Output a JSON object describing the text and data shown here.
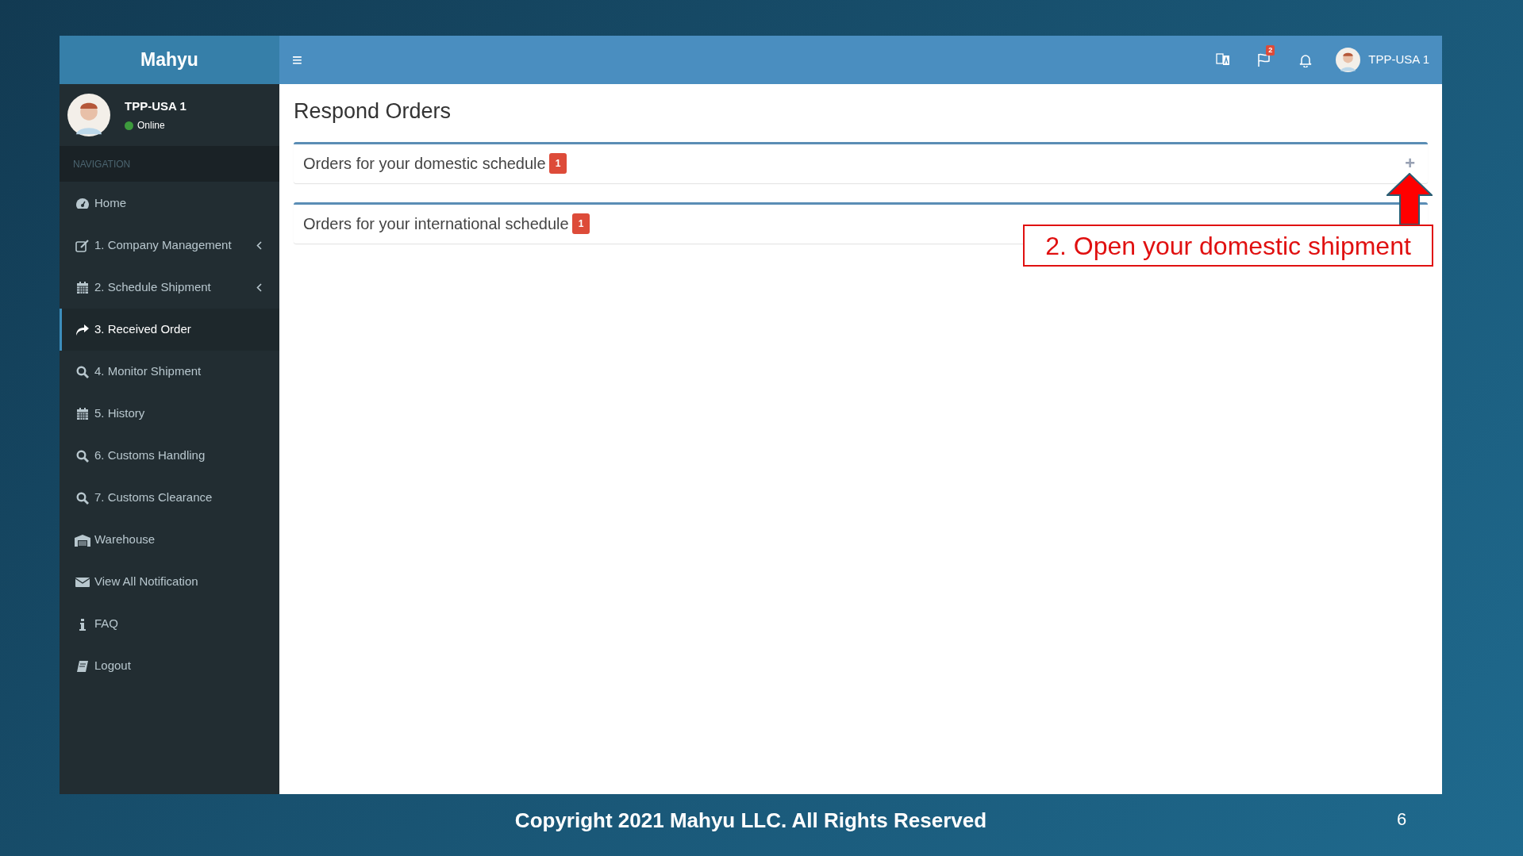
{
  "sidebar": {
    "brand": "Mahyu",
    "user": {
      "name": "TPP-USA 1",
      "status": "Online",
      "color": "#3d9a3d"
    },
    "header": "NAVIGATION",
    "items": [
      {
        "label": "Home",
        "kind": "link",
        "selected": false
      },
      {
        "label": "1. Company Management",
        "kind": "menu",
        "selected": false
      },
      {
        "label": "2. Schedule Shipment",
        "kind": "menu",
        "selected": false
      },
      {
        "label": "3. Received Order",
        "kind": "link",
        "selected": true
      },
      {
        "label": "4. Monitor Shipment",
        "kind": "link",
        "selected": false
      },
      {
        "label": "5. History",
        "kind": "link",
        "selected": false
      },
      {
        "label": "6. Customs Handling",
        "kind": "link",
        "selected": false
      },
      {
        "label": "7. Customs Clearance",
        "kind": "link",
        "selected": false
      },
      {
        "label": "Warehouse",
        "kind": "link",
        "selected": false
      },
      {
        "label": "View All Notification",
        "kind": "link",
        "selected": false
      },
      {
        "label": "FAQ",
        "kind": "link",
        "selected": false
      },
      {
        "label": "Logout",
        "kind": "link",
        "selected": false
      }
    ]
  },
  "topbar": {
    "menu_icon": "≡",
    "flag_count": "2",
    "user_name": "TPP-USA 1"
  },
  "content": {
    "title": "Respond Orders",
    "panels": [
      {
        "title": "Orders for your domestic schedule",
        "count": "1",
        "toggle": "+"
      },
      {
        "title": "Orders for your international schedule",
        "count": "1"
      }
    ]
  },
  "annotation": "2. Open your domestic shipment",
  "footer": {
    "copyright": "Copyright 2021 Mahyu LLC. All Rights Reserved",
    "page_number": "6"
  }
}
